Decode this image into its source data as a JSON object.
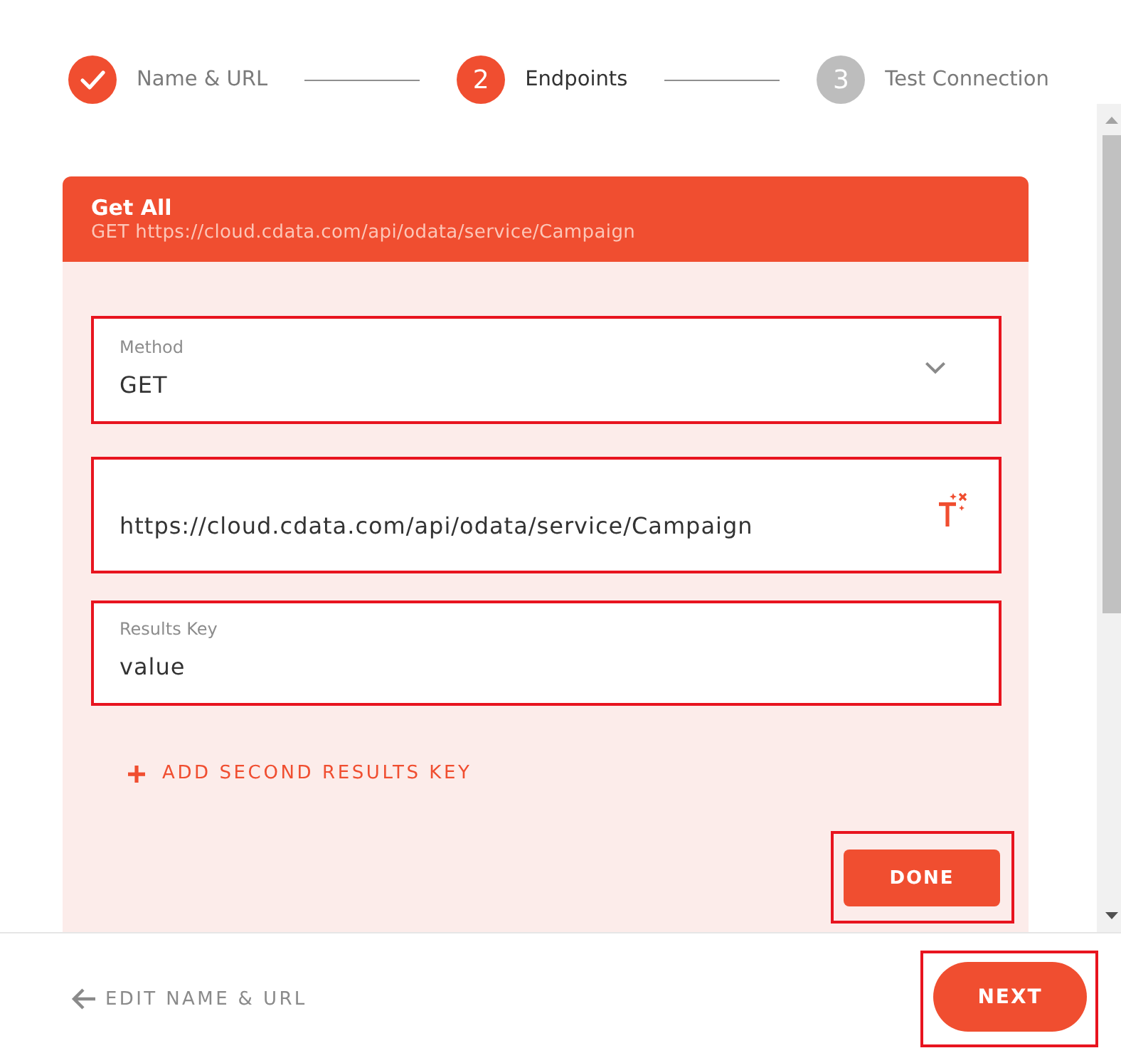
{
  "stepper": {
    "steps": [
      {
        "label": "Name & URL",
        "done": true,
        "selected": false
      },
      {
        "number": "2",
        "label": "Endpoints",
        "done": false,
        "selected": true
      },
      {
        "number": "3",
        "label": "Test Connection",
        "done": false,
        "selected": false
      }
    ]
  },
  "endpoint_card": {
    "title": "Get All",
    "subtitle": "GET https://cloud.cdata.com/api/odata/service/Campaign",
    "fields": [
      {
        "kind": "select",
        "label": "Method",
        "value": "GET",
        "highlighted": true
      },
      {
        "kind": "expression",
        "value": "https://cloud.cdata.com/api/odata/service/Campaign",
        "highlighted": true
      },
      {
        "kind": "text",
        "label": "Results Key",
        "value": "value",
        "highlighted": true
      }
    ],
    "add_link": {
      "label": "ADD SECOND RESULTS KEY"
    },
    "done_button": {
      "label": "DONE",
      "highlighted": true
    }
  },
  "footer": {
    "back_link": {
      "label": "EDIT NAME & URL"
    },
    "next_button": {
      "label": "NEXT",
      "highlighted": true
    }
  }
}
